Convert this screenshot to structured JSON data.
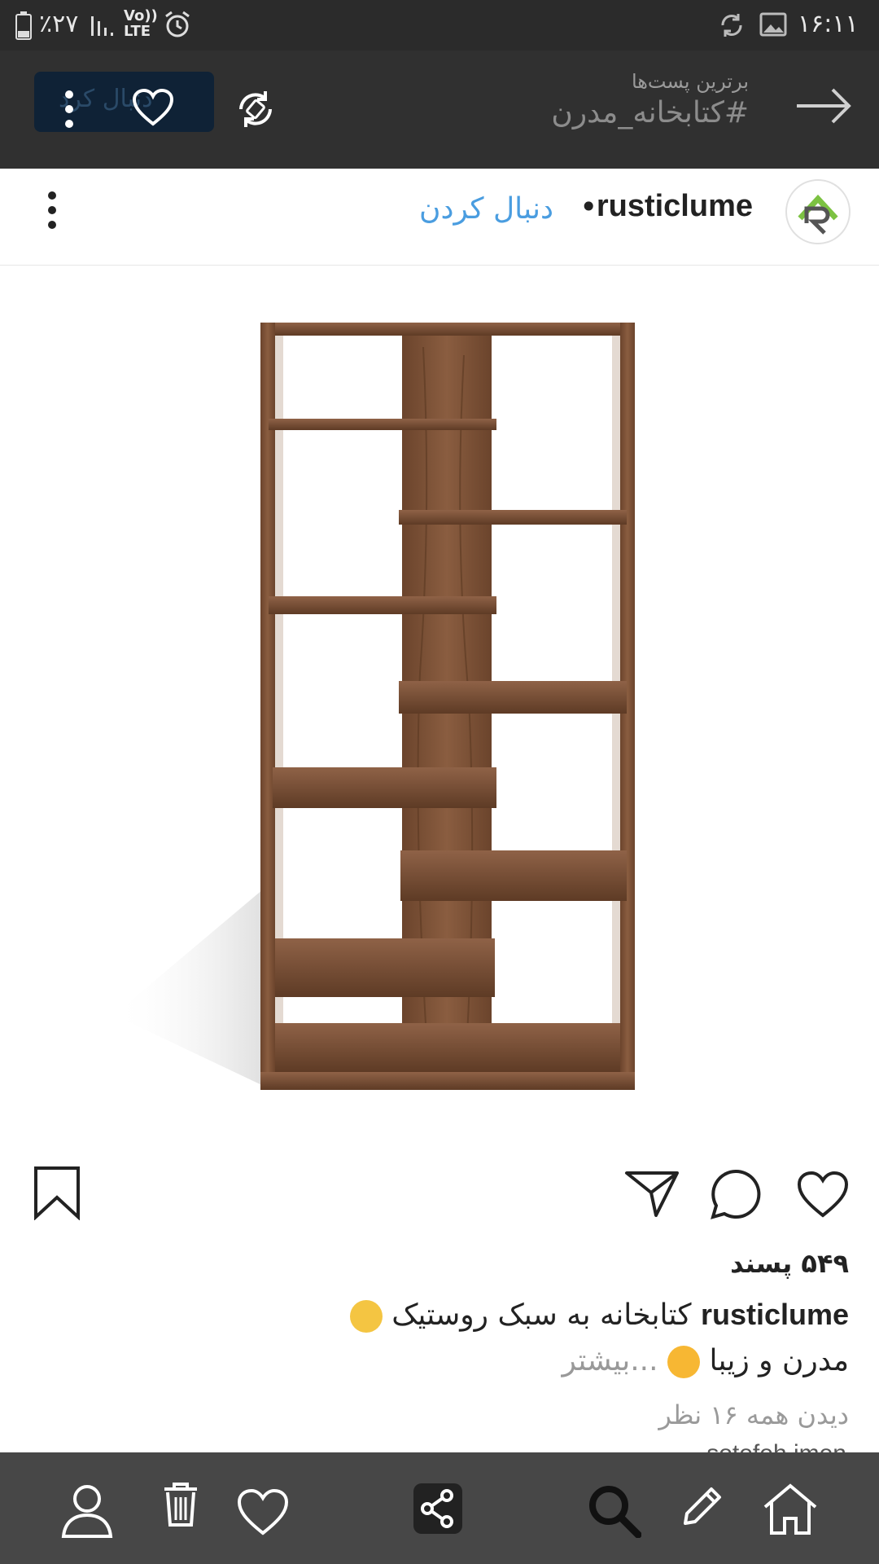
{
  "status_bar": {
    "battery": "٪۲۷",
    "network": "Vo)) LTE",
    "time": "۱۶:۱۱"
  },
  "top_bar": {
    "subtitle": "برترین پست‌ها",
    "title": "#کتابخانه_مدرن",
    "follow_pill_label": "دنبال کرد"
  },
  "post": {
    "username": "rusticlume",
    "follow_label": "دنبال کردن",
    "likes": "۵۴۹ پسند",
    "caption_user": "rusticlume",
    "caption_text": "کتابخانه به سبک روستیک",
    "caption_line2": "مدرن و زیبا",
    "more_label": "...بیشتر",
    "view_comments": "دیدن همه ۱۶ نظر",
    "next_comment_preview": "sotefeh.imen"
  },
  "icons": {
    "back": "arrow-right-icon",
    "rotate": "rotate-icon",
    "like_header": "heart-icon",
    "menu": "more-vertical-icon",
    "bookmark": "bookmark-icon",
    "send": "send-icon",
    "comment": "comment-icon",
    "like": "heart-icon"
  },
  "bottom_nav": [
    "profile-icon",
    "trash-icon",
    "heart-icon",
    "share-icon",
    "search-icon",
    "edit-icon",
    "home-icon"
  ],
  "colors": {
    "status_bg": "#2b2b2b",
    "topbar_bg": "#303030",
    "follow_blue": "#4a9de0",
    "bottombar_bg": "#474747",
    "wood": "#7a5238"
  }
}
